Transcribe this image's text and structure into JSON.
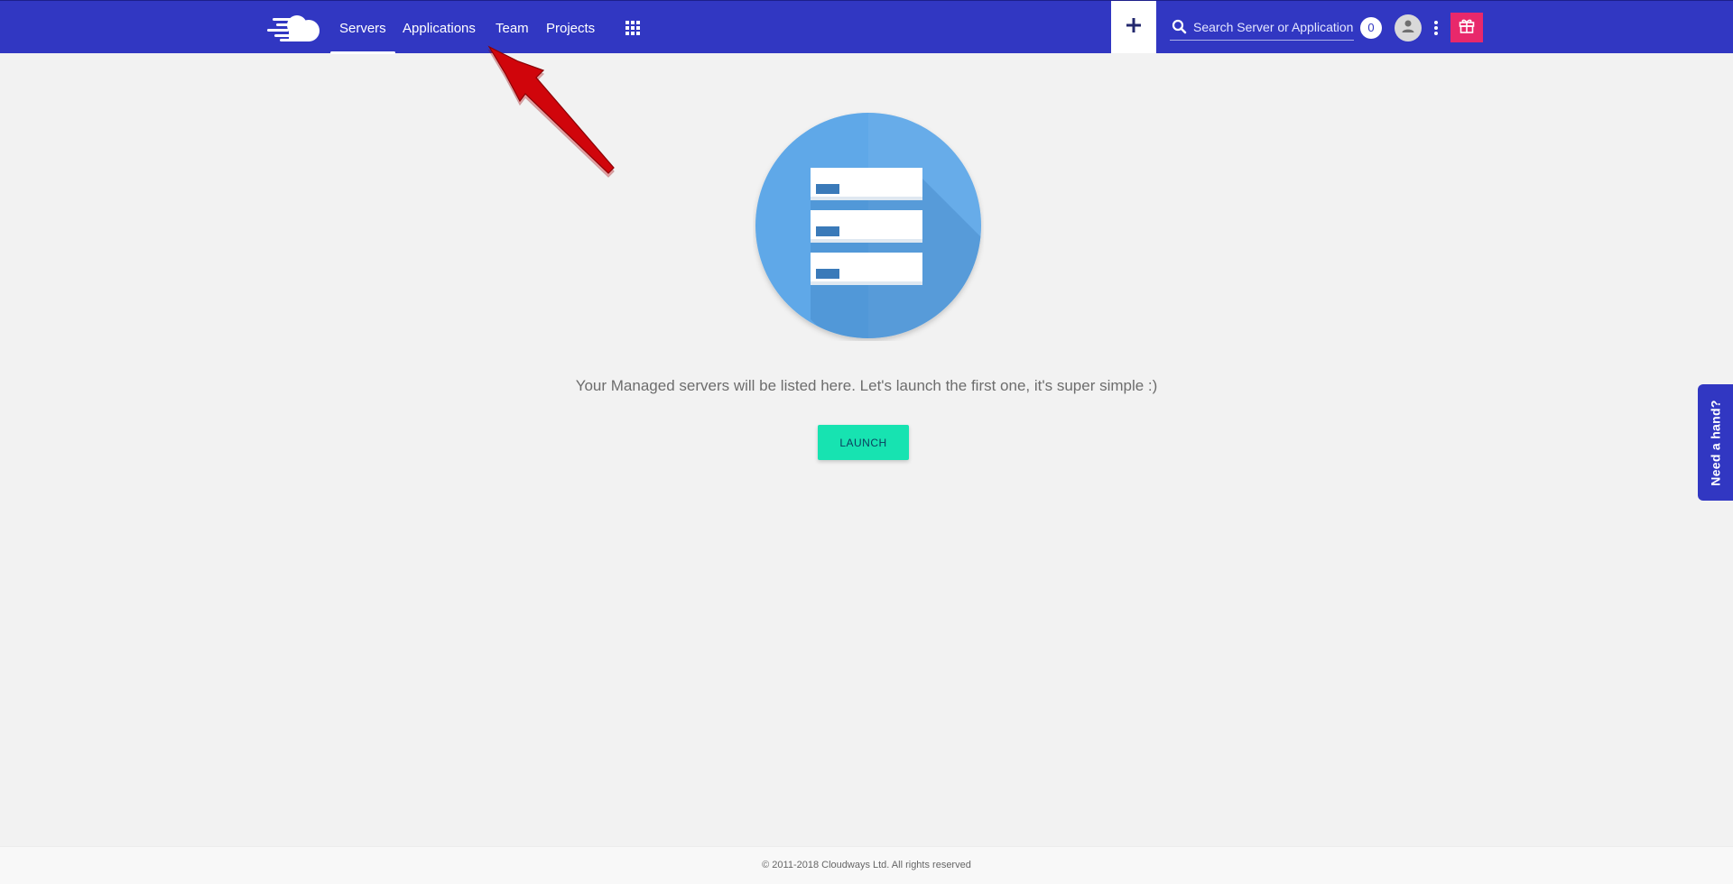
{
  "header": {
    "logo_icon": "cloudways-cloud-logo",
    "nav": [
      {
        "label": "Servers",
        "active": true
      },
      {
        "label": "Applications",
        "active": false
      },
      {
        "label": "Team",
        "active": false
      },
      {
        "label": "Projects",
        "active": false
      }
    ],
    "apps_icon": "grid-icon",
    "add_icon": "plus-icon",
    "search": {
      "placeholder": "Search Server or Application",
      "value": ""
    },
    "notification_count": "0",
    "user_icon": "user-icon",
    "more_icon": "kebab-icon",
    "gift_icon": "gift-icon"
  },
  "main": {
    "illustration": "server-stack-icon",
    "message": "Your Managed servers will be listed here. Let's launch the first one, it's super simple :)",
    "launch_label": "LAUNCH"
  },
  "help_tab": {
    "label": "Need a hand?"
  },
  "footer": {
    "copyright": "© 2011-2018 Cloudways Ltd. All rights reserved"
  },
  "colors": {
    "topbar": "#3137c2",
    "launch": "#17e3b1",
    "gift": "#e8286b",
    "illustration": "#5ea8e8",
    "annotation_arrow": "#d0050b"
  }
}
